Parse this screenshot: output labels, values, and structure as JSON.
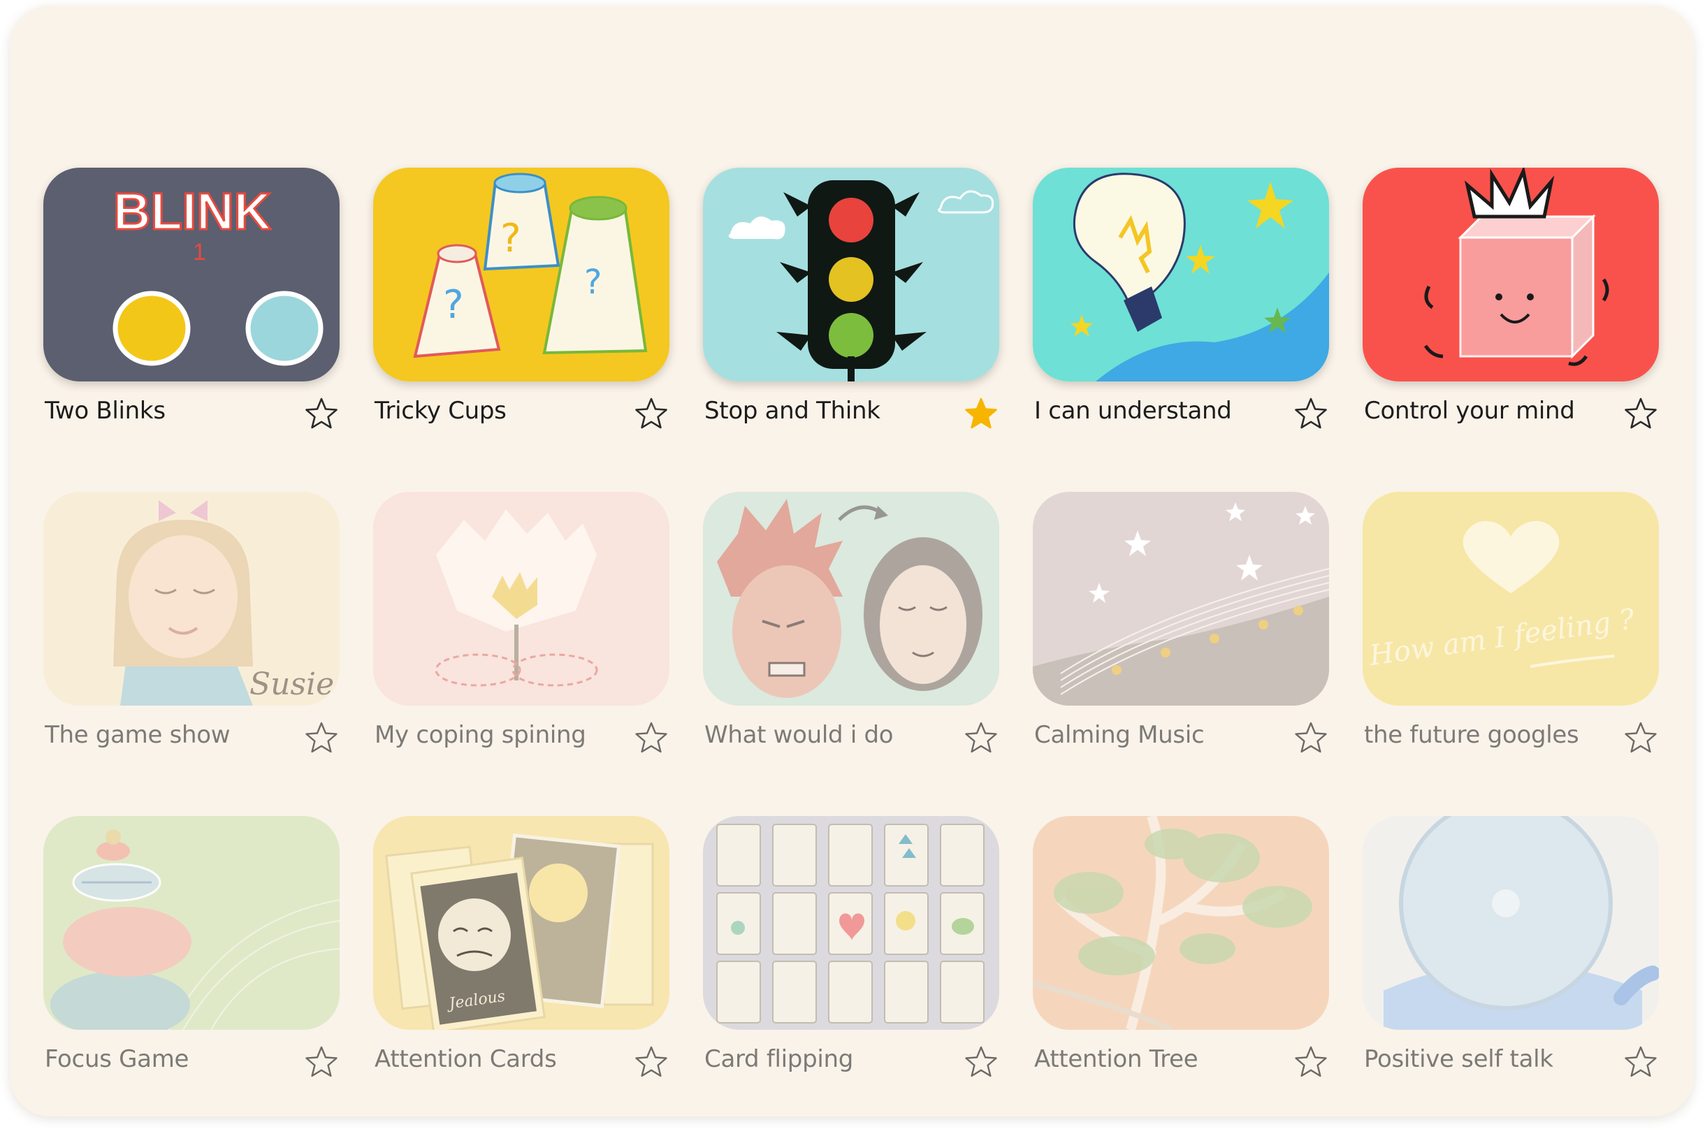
{
  "activities": [
    {
      "title": "Two Blinks",
      "starred": false,
      "image": "blink-illustration"
    },
    {
      "title": "Tricky Cups",
      "starred": false,
      "image": "cups-illustration"
    },
    {
      "title": "Stop and Think",
      "starred": true,
      "image": "traffic-light-illustration"
    },
    {
      "title": "I can understand",
      "starred": false,
      "image": "lightbulb-illustration"
    },
    {
      "title": "Control your mind",
      "starred": false,
      "image": "box-character-illustration"
    },
    {
      "title": "The game show",
      "starred": false,
      "image": "susie-illustration"
    },
    {
      "title": "My coping spining",
      "starred": false,
      "image": "flower-illustration"
    },
    {
      "title": "What would i do",
      "starred": false,
      "image": "two-faces-illustration"
    },
    {
      "title": "Calming Music",
      "starred": false,
      "image": "night-music-illustration"
    },
    {
      "title": "the future googles",
      "starred": false,
      "image": "heart-feeling-illustration"
    },
    {
      "title": "Focus Game",
      "starred": false,
      "image": "stacked-stones-illustration"
    },
    {
      "title": "Attention Cards",
      "starred": false,
      "image": "emotion-cards-illustration"
    },
    {
      "title": "Card flipping",
      "starred": false,
      "image": "card-grid-illustration"
    },
    {
      "title": "Attention Tree",
      "starred": false,
      "image": "tree-illustration"
    },
    {
      "title": "Positive self talk",
      "starred": false,
      "image": "mirror-illustration"
    }
  ],
  "image_text": {
    "blink": "BLINK",
    "blink_count": "1",
    "susie": "Susie",
    "feeling": "How am I feeling ?",
    "jealous": "Jealous"
  },
  "colors": {
    "panel": "#faf3e9",
    "star_active": "#f7b500",
    "star_outline": "#2a2a2a"
  }
}
